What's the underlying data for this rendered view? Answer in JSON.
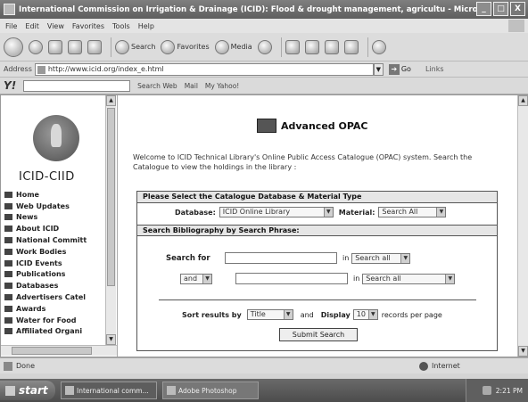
{
  "window": {
    "title": "International Commission on Irrigation & Drainage (ICID): Flood & drought management, agricultu - Microsoft ...",
    "buttons": {
      "minimize": "_",
      "maximize": "□",
      "close": "X"
    }
  },
  "menu": [
    "File",
    "Edit",
    "View",
    "Favorites",
    "Tools",
    "Help"
  ],
  "toolbar": {
    "search_label": "Search",
    "favorites_label": "Favorites",
    "media_label": "Media"
  },
  "address": {
    "label": "Address",
    "value": "http://www.icid.org/index_e.html",
    "go_label": "Go",
    "links_label": "Links"
  },
  "yahoo": {
    "logo": "Y!",
    "search_web": "Search Web",
    "mail": "Mail",
    "my_yahoo": "My Yahoo!"
  },
  "sidebar": {
    "logo_text": "ICID-CIID",
    "items": [
      "Home",
      "Web Updates",
      "News",
      "About ICID",
      "National Committ",
      "Work Bodies",
      "ICID Events",
      "Publications",
      "Databases",
      "Advertisers Catel",
      "Awards",
      "Water for Food",
      "Affiliated Organi"
    ]
  },
  "main": {
    "title": "Advanced OPAC",
    "welcome": "Welcome to ICID Technical Library's Online Public Access Catalogue (OPAC) system. Search the Catalogue to view the holdings in the library :",
    "section1": "Please Select the Catalogue Database & Material Type",
    "database_label": "Database:",
    "database_value": "ICID Online Library",
    "material_label": "Material:",
    "material_value": "Search All",
    "section2": "Search Bibliography by Search Phrase:",
    "search_for_label": "Search for",
    "in_label": "in",
    "in_value_1": "Search all",
    "operator_value": "and",
    "in_value_2": "Search all",
    "sort_label": "Sort results by",
    "sort_value": "Title",
    "and_label": "and",
    "display_label": "Display",
    "display_value": "10",
    "records_label": "records per page",
    "submit_label": "Submit Search"
  },
  "status": {
    "text": "Done",
    "zone": "Internet"
  },
  "taskbar": {
    "start": "start",
    "tasks": [
      "International comm...",
      "Adobe Photoshop"
    ],
    "clock": "2:21 PM"
  }
}
